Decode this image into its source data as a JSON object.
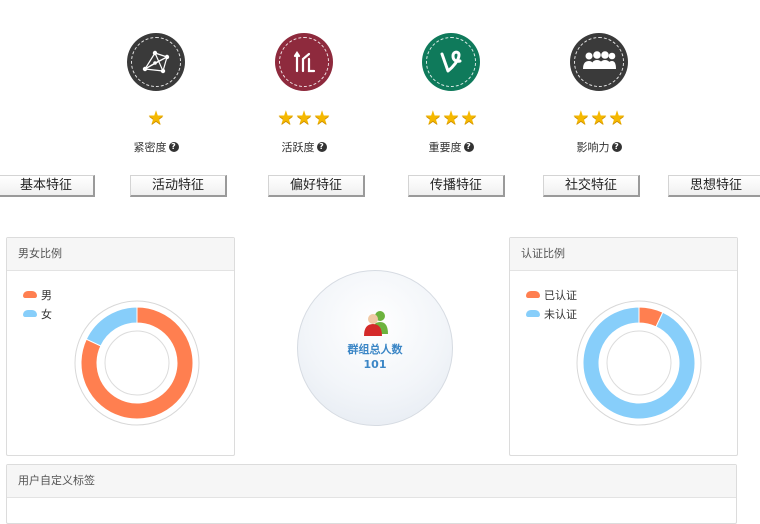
{
  "metrics": [
    {
      "label": "紧密度",
      "stars": 1,
      "icon": "network-icon",
      "color": "#3a3a3a"
    },
    {
      "label": "活跃度",
      "stars": 3,
      "icon": "activity-icon",
      "color": "#8e2a3d"
    },
    {
      "label": "重要度",
      "stars": 3,
      "icon": "vine-icon",
      "color": "#0f7a5b"
    },
    {
      "label": "影响力",
      "stars": 3,
      "icon": "group-icon",
      "color": "#3a3a3a"
    }
  ],
  "tabs": [
    "基本特征",
    "活动特征",
    "偏好特征",
    "传播特征",
    "社交特征",
    "思想特征"
  ],
  "gender_panel": {
    "title": "男女比例",
    "legend": [
      {
        "label": "男",
        "color": "#ff7f50"
      },
      {
        "label": "女",
        "color": "#87cefa"
      }
    ],
    "share": [
      0.82,
      0.18
    ]
  },
  "group_total": {
    "label": "群组总人数",
    "value": "101"
  },
  "verify_panel": {
    "title": "认证比例",
    "legend": [
      {
        "label": "已认证",
        "color": "#ff7f50"
      },
      {
        "label": "未认证",
        "color": "#87cefa"
      }
    ],
    "share": [
      0.07,
      0.93
    ]
  },
  "tags_panel": {
    "title": "用户自定义标签"
  }
}
